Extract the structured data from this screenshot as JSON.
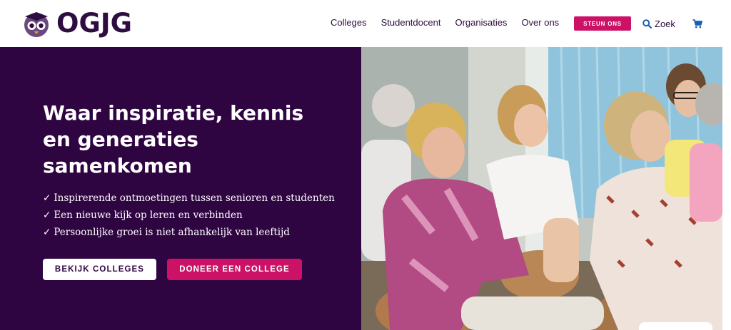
{
  "logo": {
    "text": "OGJG"
  },
  "nav": {
    "items": [
      "Colleges",
      "Studentdocent",
      "Organisaties",
      "Over ons"
    ],
    "steun_label": "STEUN ONS",
    "search_label": "Zoek"
  },
  "hero": {
    "title": "Waar inspiratie, kennis en generaties samenkomen",
    "checks": [
      "Inspirerende ontmoetingen tussen senioren en studenten",
      "Een nieuwe kijk op leren en verbinden",
      "Persoonlijke groei is niet afhankelijk van leeftijd"
    ],
    "check_mark": "✓",
    "primary_button": "BEKIJK COLLEGES",
    "secondary_button": "DONEER EEN COLLEGE",
    "photo_alt": "Senioren en studenten luisteren samen lachend naar een college"
  },
  "colors": {
    "brand_dark": "#2e0441",
    "brand_pink": "#cc1266"
  },
  "icons": {
    "logo": "owl-icon",
    "search": "search-icon",
    "cart": "cart-icon"
  }
}
